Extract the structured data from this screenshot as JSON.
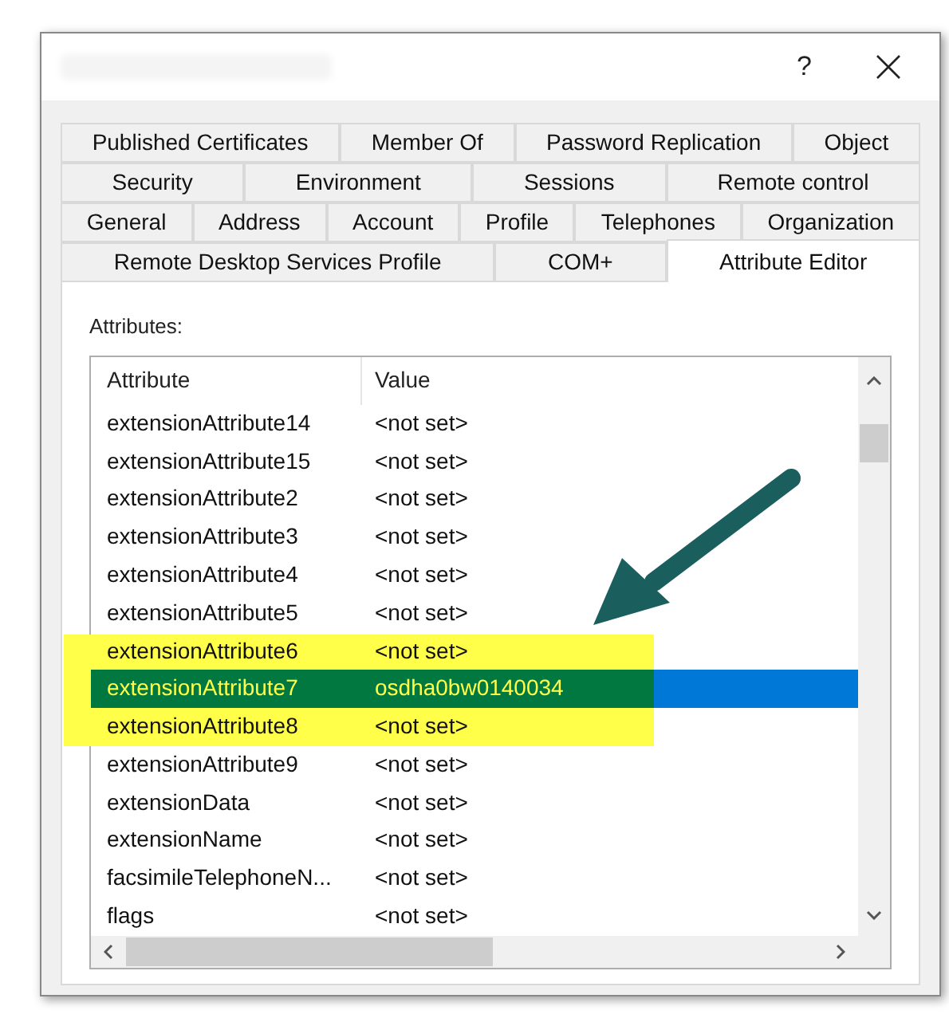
{
  "window": {
    "help": "?"
  },
  "tab_rows": [
    [
      {
        "label": "Published Certificates",
        "selected": false
      },
      {
        "label": "Member Of",
        "selected": false
      },
      {
        "label": "Password Replication",
        "selected": false
      },
      {
        "label": "Object",
        "selected": false
      }
    ],
    [
      {
        "label": "Security",
        "selected": false
      },
      {
        "label": "Environment",
        "selected": false
      },
      {
        "label": "Sessions",
        "selected": false
      },
      {
        "label": "Remote control",
        "selected": false
      }
    ],
    [
      {
        "label": "General",
        "selected": false
      },
      {
        "label": "Address",
        "selected": false
      },
      {
        "label": "Account",
        "selected": false
      },
      {
        "label": "Profile",
        "selected": false
      },
      {
        "label": "Telephones",
        "selected": false
      },
      {
        "label": "Organization",
        "selected": false
      }
    ],
    [
      {
        "label": "Remote Desktop Services Profile",
        "selected": false
      },
      {
        "label": "COM+",
        "selected": false
      },
      {
        "label": "Attribute Editor",
        "selected": true
      }
    ]
  ],
  "attributes_label": "Attributes:",
  "table": {
    "columns": [
      "Attribute",
      "Value"
    ],
    "rows": [
      {
        "attribute": "extensionAttribute14",
        "value": "<not set>",
        "selected": false
      },
      {
        "attribute": "extensionAttribute15",
        "value": "<not set>",
        "selected": false
      },
      {
        "attribute": "extensionAttribute2",
        "value": "<not set>",
        "selected": false
      },
      {
        "attribute": "extensionAttribute3",
        "value": "<not set>",
        "selected": false
      },
      {
        "attribute": "extensionAttribute4",
        "value": "<not set>",
        "selected": false
      },
      {
        "attribute": "extensionAttribute5",
        "value": "<not set>",
        "selected": false
      },
      {
        "attribute": "extensionAttribute6",
        "value": "<not set>",
        "selected": false
      },
      {
        "attribute": "extensionAttribute7",
        "value": "osdha0bw0140034",
        "selected": true
      },
      {
        "attribute": "extensionAttribute8",
        "value": "<not set>",
        "selected": false
      },
      {
        "attribute": "extensionAttribute9",
        "value": "<not set>",
        "selected": false
      },
      {
        "attribute": "extensionData",
        "value": "<not set>",
        "selected": false
      },
      {
        "attribute": "extensionName",
        "value": "<not set>",
        "selected": false
      },
      {
        "attribute": "facsimileTelephoneN...",
        "value": "<not set>",
        "selected": false
      },
      {
        "attribute": "flags",
        "value": "<not set>",
        "selected": false
      }
    ]
  }
}
